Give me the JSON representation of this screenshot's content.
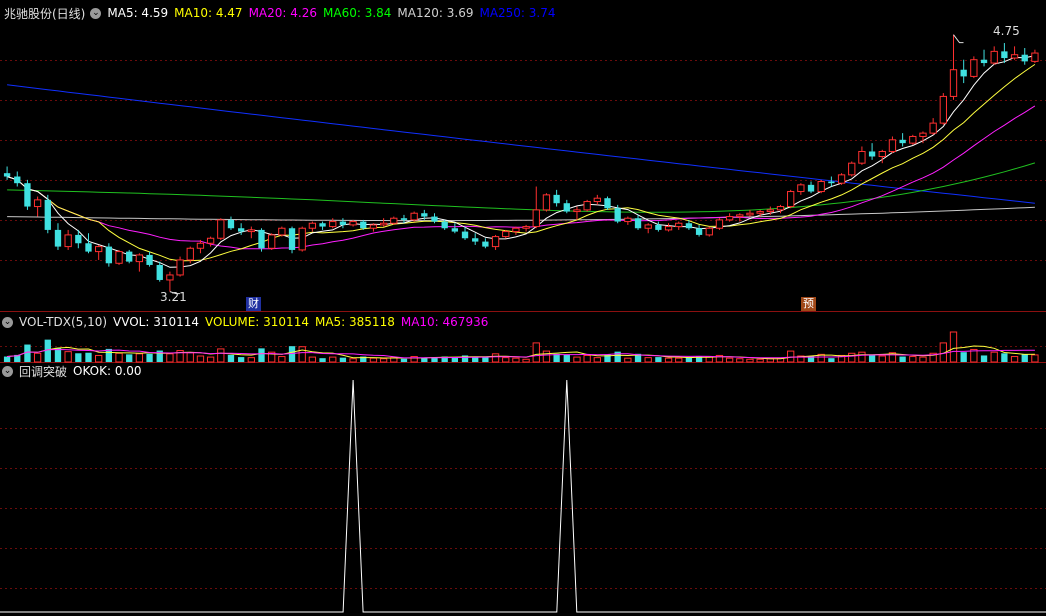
{
  "main_panel": {
    "title": "兆驰股份(日线)",
    "ma_items": [
      {
        "label": "MA5: 4.59",
        "color": "#ffffff"
      },
      {
        "label": "MA10: 4.47",
        "color": "#ffff00"
      },
      {
        "label": "MA20: 4.26",
        "color": "#ff00ff"
      },
      {
        "label": "MA60: 3.84",
        "color": "#00ff00"
      },
      {
        "label": "MA120: 3.69",
        "color": "#d0d0d0"
      },
      {
        "label": "MA250: 3.74",
        "color": "#0000ff"
      }
    ],
    "high_label": "4.75",
    "low_label": "3.21",
    "marker_cai": "财",
    "marker_yu": "预"
  },
  "volume_panel": {
    "title": "VOL-TDX(5,10)",
    "items": [
      {
        "label": "VVOL: 310114",
        "color": "#ffffff"
      },
      {
        "label": "VOLUME: 310114",
        "color": "#ffff00"
      },
      {
        "label": "MA5: 385118",
        "color": "#ffff00"
      },
      {
        "label": "MA10: 467936",
        "color": "#ff00ff"
      }
    ]
  },
  "indicator_panel": {
    "title": "回调突破",
    "items": [
      {
        "label": "OKOK: 0.00",
        "color": "#ffffff"
      }
    ]
  },
  "chart_data": [
    {
      "type": "candlestick",
      "title": "兆驰股份(日线)",
      "high": 4.75,
      "low": 3.21,
      "ylim": [
        3.1,
        4.85
      ],
      "series": [
        {
          "name": "MA5",
          "value": 4.59
        },
        {
          "name": "MA10",
          "value": 4.47
        },
        {
          "name": "MA20",
          "value": 4.26
        },
        {
          "name": "MA60",
          "value": 3.84
        },
        {
          "name": "MA120",
          "value": 3.69
        },
        {
          "name": "MA250",
          "value": 3.74
        }
      ],
      "candles": [
        [
          3.92,
          3.96,
          3.88,
          3.9
        ],
        [
          3.9,
          3.93,
          3.84,
          3.86
        ],
        [
          3.86,
          3.88,
          3.7,
          3.72
        ],
        [
          3.72,
          3.78,
          3.66,
          3.76
        ],
        [
          3.76,
          3.79,
          3.56,
          3.58
        ],
        [
          3.58,
          3.62,
          3.46,
          3.48
        ],
        [
          3.48,
          3.58,
          3.46,
          3.55
        ],
        [
          3.55,
          3.58,
          3.47,
          3.5
        ],
        [
          3.5,
          3.56,
          3.44,
          3.45
        ],
        [
          3.45,
          3.49,
          3.4,
          3.48
        ],
        [
          3.48,
          3.5,
          3.36,
          3.38
        ],
        [
          3.38,
          3.46,
          3.37,
          3.45
        ],
        [
          3.45,
          3.46,
          3.38,
          3.39
        ],
        [
          3.39,
          3.44,
          3.33,
          3.43
        ],
        [
          3.43,
          3.45,
          3.36,
          3.37
        ],
        [
          3.37,
          3.39,
          3.27,
          3.28
        ],
        [
          3.28,
          3.33,
          3.21,
          3.31
        ],
        [
          3.31,
          3.42,
          3.3,
          3.4
        ],
        [
          3.4,
          3.48,
          3.38,
          3.47
        ],
        [
          3.47,
          3.52,
          3.44,
          3.5
        ],
        [
          3.5,
          3.54,
          3.48,
          3.53
        ],
        [
          3.53,
          3.65,
          3.52,
          3.64
        ],
        [
          3.64,
          3.66,
          3.58,
          3.59
        ],
        [
          3.59,
          3.62,
          3.55,
          3.57
        ],
        [
          3.57,
          3.6,
          3.53,
          3.58
        ],
        [
          3.58,
          3.59,
          3.45,
          3.47
        ],
        [
          3.47,
          3.56,
          3.46,
          3.55
        ],
        [
          3.55,
          3.6,
          3.54,
          3.59
        ],
        [
          3.59,
          3.6,
          3.44,
          3.46
        ],
        [
          3.46,
          3.6,
          3.45,
          3.59
        ],
        [
          3.59,
          3.63,
          3.57,
          3.62
        ],
        [
          3.62,
          3.63,
          3.58,
          3.6
        ],
        [
          3.6,
          3.65,
          3.59,
          3.63
        ],
        [
          3.63,
          3.65,
          3.59,
          3.61
        ],
        [
          3.61,
          3.64,
          3.6,
          3.63
        ],
        [
          3.63,
          3.64,
          3.58,
          3.59
        ],
        [
          3.59,
          3.62,
          3.57,
          3.61
        ],
        [
          3.61,
          3.65,
          3.6,
          3.62
        ],
        [
          3.62,
          3.66,
          3.61,
          3.65
        ],
        [
          3.65,
          3.67,
          3.62,
          3.64
        ],
        [
          3.64,
          3.69,
          3.63,
          3.68
        ],
        [
          3.68,
          3.7,
          3.64,
          3.66
        ],
        [
          3.66,
          3.68,
          3.62,
          3.63
        ],
        [
          3.63,
          3.64,
          3.58,
          3.59
        ],
        [
          3.59,
          3.62,
          3.56,
          3.57
        ],
        [
          3.57,
          3.6,
          3.52,
          3.53
        ],
        [
          3.53,
          3.56,
          3.49,
          3.51
        ],
        [
          3.51,
          3.53,
          3.47,
          3.48
        ],
        [
          3.48,
          3.55,
          3.46,
          3.54
        ],
        [
          3.54,
          3.58,
          3.53,
          3.57
        ],
        [
          3.57,
          3.6,
          3.55,
          3.59
        ],
        [
          3.59,
          3.61,
          3.57,
          3.6
        ],
        [
          3.6,
          3.84,
          3.59,
          3.7
        ],
        [
          3.7,
          3.8,
          3.69,
          3.79
        ],
        [
          3.79,
          3.82,
          3.72,
          3.74
        ],
        [
          3.74,
          3.76,
          3.68,
          3.69
        ],
        [
          3.69,
          3.72,
          3.64,
          3.7
        ],
        [
          3.7,
          3.76,
          3.69,
          3.75
        ],
        [
          3.75,
          3.79,
          3.73,
          3.77
        ],
        [
          3.77,
          3.78,
          3.7,
          3.71
        ],
        [
          3.71,
          3.73,
          3.62,
          3.63
        ],
        [
          3.63,
          3.66,
          3.61,
          3.65
        ],
        [
          3.65,
          3.67,
          3.58,
          3.59
        ],
        [
          3.59,
          3.62,
          3.56,
          3.61
        ],
        [
          3.61,
          3.63,
          3.57,
          3.58
        ],
        [
          3.58,
          3.62,
          3.57,
          3.6
        ],
        [
          3.6,
          3.63,
          3.58,
          3.62
        ],
        [
          3.62,
          3.64,
          3.58,
          3.59
        ],
        [
          3.59,
          3.61,
          3.54,
          3.55
        ],
        [
          3.55,
          3.6,
          3.54,
          3.59
        ],
        [
          3.59,
          3.65,
          3.58,
          3.64
        ],
        [
          3.64,
          3.68,
          3.63,
          3.66
        ],
        [
          3.66,
          3.68,
          3.63,
          3.67
        ],
        [
          3.67,
          3.7,
          3.66,
          3.68
        ],
        [
          3.68,
          3.7,
          3.66,
          3.69
        ],
        [
          3.69,
          3.72,
          3.67,
          3.7
        ],
        [
          3.7,
          3.73,
          3.68,
          3.72
        ],
        [
          3.72,
          3.82,
          3.71,
          3.81
        ],
        [
          3.81,
          3.86,
          3.79,
          3.85
        ],
        [
          3.85,
          3.87,
          3.8,
          3.81
        ],
        [
          3.81,
          3.88,
          3.8,
          3.87
        ],
        [
          3.87,
          3.9,
          3.84,
          3.86
        ],
        [
          3.86,
          3.92,
          3.85,
          3.91
        ],
        [
          3.91,
          3.99,
          3.9,
          3.98
        ],
        [
          3.98,
          4.08,
          3.97,
          4.05
        ],
        [
          4.05,
          4.1,
          4.0,
          4.02
        ],
        [
          4.02,
          4.06,
          3.98,
          4.05
        ],
        [
          4.05,
          4.14,
          4.04,
          4.12
        ],
        [
          4.12,
          4.16,
          4.08,
          4.1
        ],
        [
          4.1,
          4.15,
          4.09,
          4.14
        ],
        [
          4.14,
          4.17,
          4.1,
          4.16
        ],
        [
          4.16,
          4.25,
          4.15,
          4.22
        ],
        [
          4.22,
          4.4,
          4.21,
          4.38
        ],
        [
          4.38,
          4.75,
          4.36,
          4.54
        ],
        [
          4.54,
          4.6,
          4.46,
          4.5
        ],
        [
          4.5,
          4.62,
          4.49,
          4.6
        ],
        [
          4.6,
          4.66,
          4.56,
          4.58
        ],
        [
          4.58,
          4.68,
          4.57,
          4.65
        ],
        [
          4.65,
          4.7,
          4.58,
          4.61
        ],
        [
          4.61,
          4.68,
          4.6,
          4.63
        ],
        [
          4.63,
          4.67,
          4.57,
          4.59
        ],
        [
          4.59,
          4.66,
          4.58,
          4.64
        ]
      ]
    },
    {
      "type": "bar",
      "title": "VOL-TDX(5,10)",
      "series": [
        {
          "name": "VVOL",
          "value": 310114
        },
        {
          "name": "VOLUME",
          "value": 310114
        },
        {
          "name": "MA5",
          "value": 385118
        },
        {
          "name": "MA10",
          "value": 467936
        }
      ]
    },
    {
      "type": "line",
      "title": "回调突破",
      "series": [
        {
          "name": "OKOK",
          "value": 0.0
        }
      ],
      "signals": [
        {
          "bar_index": 34,
          "value": 1.0
        },
        {
          "bar_index": 55,
          "value": 1.0
        }
      ],
      "ylim": [
        0,
        1
      ]
    }
  ]
}
